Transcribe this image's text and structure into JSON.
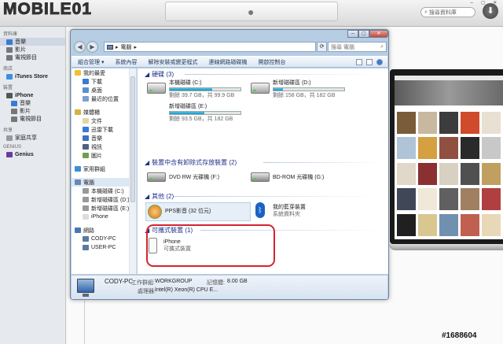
{
  "itunes": {
    "search_placeholder": "搜尋資料庫",
    "sidebar": [
      {
        "head": "資料庫"
      },
      {
        "item": "音樂",
        "sel": true,
        "color": "#3a7bd5"
      },
      {
        "item": "影片",
        "color": "#777"
      },
      {
        "item": "電視節目",
        "color": "#777"
      },
      {
        "head": "商店"
      },
      {
        "item": "iTunes Store",
        "bold": true,
        "color": "#3b8fe0"
      },
      {
        "head": "裝置"
      },
      {
        "item": "iPhone",
        "bold": true,
        "color": "#555"
      },
      {
        "item": "音樂",
        "sub": true,
        "color": "#3a7bd5"
      },
      {
        "item": "影片",
        "sub": true,
        "color": "#777"
      },
      {
        "item": "電視節目",
        "sub": true,
        "color": "#777"
      },
      {
        "head": "共享"
      },
      {
        "item": "家庭共享",
        "color": "#999"
      },
      {
        "head": "GENIUS"
      },
      {
        "item": "Genius",
        "bold": true,
        "color": "#6a3ca0"
      }
    ],
    "tiles": [
      "#7a5c3a",
      "#c8b8a0",
      "#3c3c3c",
      "#d04a2c",
      "#e8e0d0",
      "#b0c4d8",
      "#d4a040",
      "#905040",
      "#2a2a2a",
      "#c8c8c8",
      "#e0d8c8",
      "#8a3030",
      "#d8d0c0",
      "#505050",
      "#c0a060",
      "#404858",
      "#f0e8d8",
      "#606060",
      "#a08060",
      "#b04040",
      "#202020",
      "#d8c890",
      "#7090b0",
      "#c06050",
      "#e8d8b8"
    ]
  },
  "explorer": {
    "breadcrumb": [
      "電腦",
      "▸"
    ],
    "search_placeholder": "搜尋 電腦",
    "toolbar": [
      "組合管理 ▾",
      "系統內容",
      "解除安裝或變更程式",
      "連線網路磁碟機",
      "開啟控制台"
    ],
    "nav": [
      {
        "label": "我的最愛",
        "level": 0,
        "color": "#f0c030"
      },
      {
        "label": "下載",
        "level": 1,
        "color": "#3a7bd5"
      },
      {
        "label": "桌面",
        "level": 1,
        "color": "#5a8fd0"
      },
      {
        "label": "最近的位置",
        "level": 1,
        "color": "#7aa0d0"
      },
      {
        "gap": true
      },
      {
        "label": "媒體櫃",
        "level": 0,
        "color": "#d8b040"
      },
      {
        "label": "文件",
        "level": 1,
        "color": "#e0d8a0"
      },
      {
        "label": "迅雷下載",
        "level": 1,
        "color": "#3a7bd5"
      },
      {
        "label": "音樂",
        "level": 1,
        "color": "#4070c0"
      },
      {
        "label": "視訊",
        "level": 1,
        "color": "#506080"
      },
      {
        "label": "圖片",
        "level": 1,
        "color": "#70a050"
      },
      {
        "gap": true
      },
      {
        "label": "家用群組",
        "level": 0,
        "color": "#3a8fd5"
      },
      {
        "gap": true
      },
      {
        "label": "電腦",
        "level": 0,
        "color": "#6a88b0",
        "sel": true
      },
      {
        "label": "本機磁碟 (C:)",
        "level": 1,
        "color": "#999"
      },
      {
        "label": "新增磁碟區 (D:)",
        "level": 1,
        "color": "#999"
      },
      {
        "label": "新增磁碟區 (E:)",
        "level": 1,
        "color": "#999"
      },
      {
        "label": "iPhone",
        "level": 1,
        "color": "#ddd"
      },
      {
        "gap": true
      },
      {
        "label": "網路",
        "level": 0,
        "color": "#4a78b0"
      },
      {
        "label": "CODY-PC",
        "level": 1,
        "color": "#5a7aa0"
      },
      {
        "label": "USER-PC",
        "level": 1,
        "color": "#5a7aa0"
      }
    ],
    "groups": {
      "hdd": "硬碟 (3)",
      "removable": "裝置中含有卸除式存放裝置 (2)",
      "other": "其他 (2)",
      "portable": "可攜式裝置 (1)"
    },
    "drives": [
      {
        "name": "本機磁碟 (C:)",
        "info": "剩餘 39.7 GB，共 99.9 GB",
        "used_fraction": 0.6
      },
      {
        "name": "新增磁碟區 (D:)",
        "info": "剩餘 158 GB，共 182 GB",
        "used_fraction": 0.13
      },
      {
        "name": "新增磁碟區 (E:)",
        "info": "剩餘 93.5 GB，共 182 GB",
        "used_fraction": 0.49
      }
    ],
    "removable": [
      {
        "name": "DVD RW 光碟機 (F:)"
      },
      {
        "name": "BD-ROM 光碟機 (G:)"
      }
    ],
    "other": [
      {
        "name": "PPS影音 (32 位元)"
      },
      {
        "name": "我的藍芽裝置",
        "sub": "系統資料夾"
      }
    ],
    "portable": {
      "name": "iPhone",
      "sub": "可攜式裝置"
    },
    "details": {
      "name": "CODY-PC",
      "workgroup_label": "工作群組:",
      "workgroup": "WORKGROUP",
      "memory_label": "記憶體:",
      "memory": "8.00 GB",
      "cpu_label": "處理器:",
      "cpu": "Intel(R) Xeon(R) CPU E..."
    }
  },
  "watermark": "#1688604",
  "logo": "MOBILE01"
}
